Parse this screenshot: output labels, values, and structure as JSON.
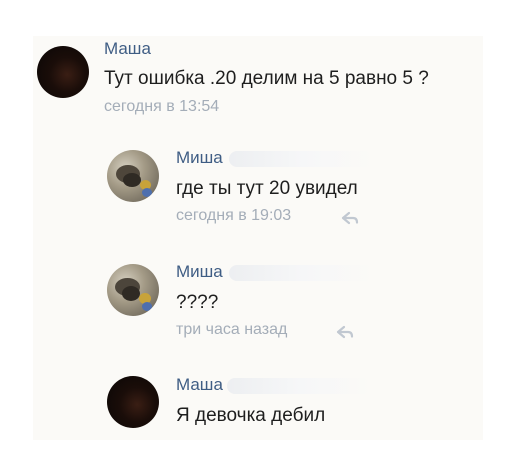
{
  "messages": [
    {
      "sender": "Маша",
      "text": "Тут ошибка .20 делим на 5 равно 5 ?",
      "time": "сегодня в 13:54",
      "avatar_icon": "dark-avatar",
      "reply_icon": false
    },
    {
      "sender": "Миша",
      "text": "где ты тут 20 увидел",
      "time": "сегодня в 19:03",
      "avatar_icon": "cat-avatar",
      "reply_icon": "reply-icon"
    },
    {
      "sender": "Миша",
      "text": "????",
      "time": "три часа назад",
      "avatar_icon": "cat-avatar",
      "reply_icon": "reply-icon"
    },
    {
      "sender": "Маша",
      "text": "Я девочка дебил",
      "time": "",
      "avatar_icon": "dark-avatar",
      "reply_icon": false
    }
  ],
  "colors": {
    "background": "#fbfaf7",
    "sender_name": "#3f5d84",
    "message_text": "#1e1e1e",
    "timestamp": "#a4adb8"
  }
}
